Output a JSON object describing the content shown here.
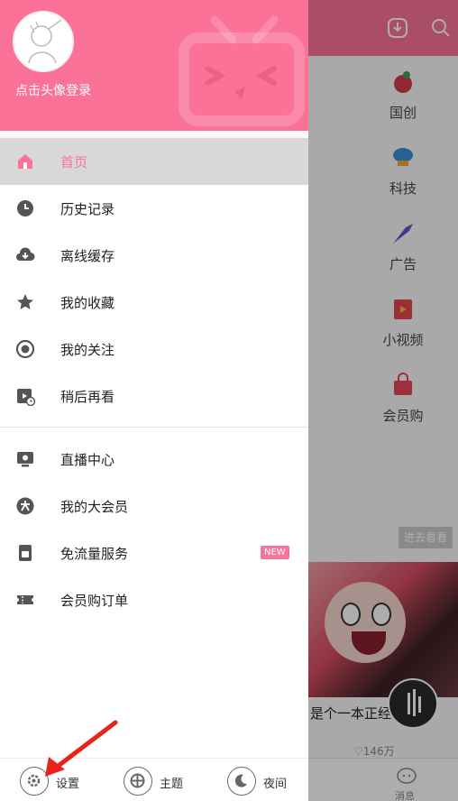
{
  "drawer": {
    "login_text": "点击头像登录",
    "menu_items": [
      {
        "label": "首页",
        "icon": "home-icon",
        "active": true
      },
      {
        "label": "历史记录",
        "icon": "clock-icon"
      },
      {
        "label": "离线缓存",
        "icon": "cloud-download-icon"
      },
      {
        "label": "我的收藏",
        "icon": "star-icon"
      },
      {
        "label": "我的关注",
        "icon": "target-icon"
      },
      {
        "label": "稍后再看",
        "icon": "watch-later-icon"
      },
      {
        "label": "直播中心",
        "icon": "live-monitor-icon"
      },
      {
        "label": "我的大会员",
        "icon": "vip-icon"
      },
      {
        "label": "免流量服务",
        "icon": "sim-card-icon",
        "badge": "NEW"
      },
      {
        "label": "会员购订单",
        "icon": "ticket-icon"
      }
    ],
    "footer": {
      "settings": "设置",
      "theme": "主题",
      "night": "夜间"
    }
  },
  "background": {
    "categories": [
      "国创",
      "科技",
      "广告",
      "小视频",
      "会员购"
    ],
    "watch_label": "进去看看",
    "caption": "是个一本正经",
    "likes": "146万",
    "message_label": "消息"
  },
  "colors": {
    "accent": "#fb7299",
    "active_row": "#d8d8d8",
    "annotation_arrow": "#e8231a"
  }
}
